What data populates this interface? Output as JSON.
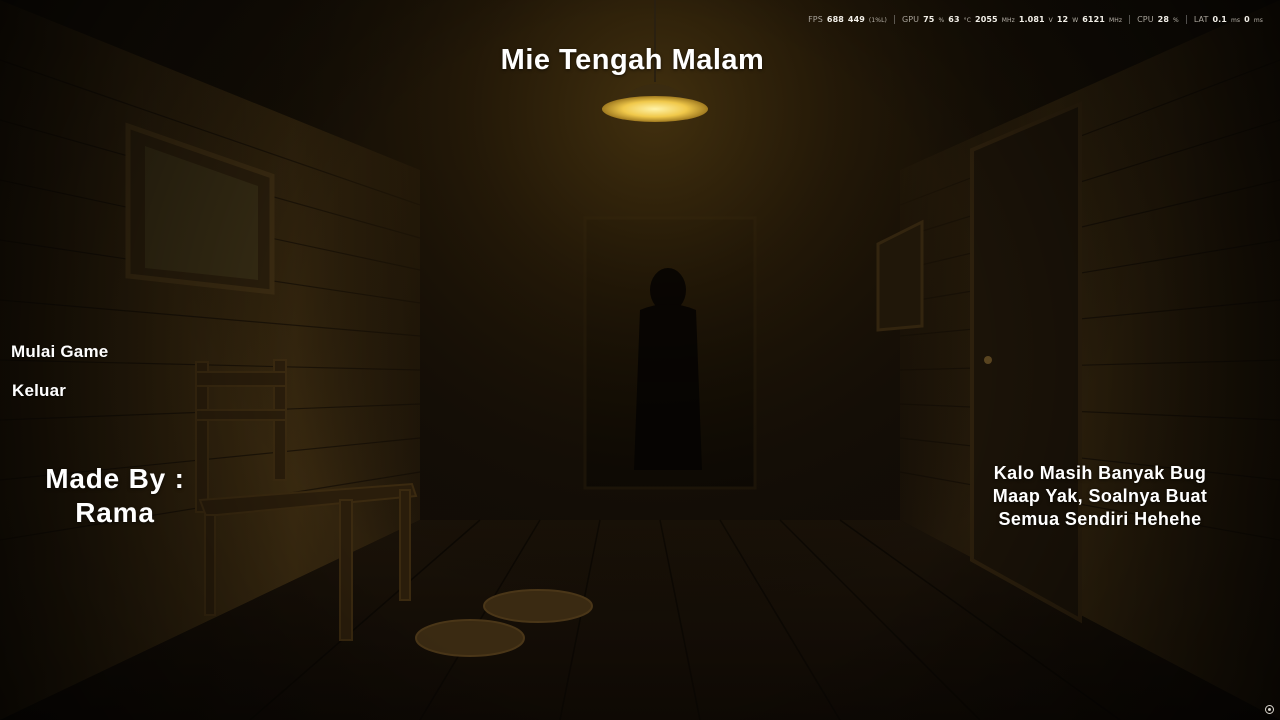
{
  "game": {
    "title": "Mie Tengah Malam"
  },
  "menu": {
    "start_label": "Mulai Game",
    "exit_label": "Keluar"
  },
  "credits": {
    "line1": "Made By :",
    "line2": "Rama"
  },
  "note": {
    "line1": "Kalo Masih Banyak Bug",
    "line2": "Maap Yak, Soalnya Buat",
    "line3": "Semua Sendiri Hehehe"
  },
  "hud": {
    "fps_label": "FPS",
    "fps_value": "688",
    "fps_low_value": "449",
    "fps_low_unit": "(1%L)",
    "gpu_label": "GPU",
    "gpu_load_value": "75",
    "gpu_load_unit": "%",
    "gpu_temp_value": "63",
    "gpu_temp_unit": "°C",
    "gpu_clock_value": "2055",
    "gpu_clock_unit": "MHz",
    "gpu_volt_value": "1.081",
    "gpu_volt_unit": "V",
    "gpu_power_value": "12",
    "gpu_power_unit": "W",
    "gpu_mem_value": "6121",
    "gpu_mem_unit": "MHz",
    "cpu_label": "CPU",
    "cpu_value": "28",
    "cpu_unit": "%",
    "lat_label": "LAT",
    "lat_value1": "0.1",
    "lat_unit1": "ms",
    "lat_value2": "0",
    "lat_unit2": "ms"
  },
  "colors": {
    "lamp_light": "#f0c84a",
    "wall_dark": "#1a1208",
    "text": "#ffffff"
  },
  "icons": {
    "corner": "target-icon"
  }
}
